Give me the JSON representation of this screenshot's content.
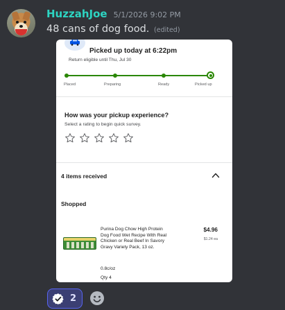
{
  "message": {
    "username": "HuzzahJoe",
    "timestamp": "5/1/2026 9:02 PM",
    "text": "48 cans of dog food.",
    "edited_label": "(edited)"
  },
  "embed": {
    "pickup_title": "Picked up today at 6:22pm",
    "return_note": "Return eligible until Thu, Jul 30",
    "progress_stages": [
      "Placed",
      "Preparing",
      "Ready",
      "Picked up"
    ],
    "rating_question": "How was your pickup experience?",
    "rating_subtitle": "Select a rating to begin quick survey.",
    "star_count": 5,
    "items_received": "4 items received",
    "section_label": "Shopped",
    "product": {
      "name": "Purina Dog Chow High Protein Dog Food Wet Recipe With Real Chicken or Real Beef In Savory Gravy Variety Pack, 13 oz.",
      "price": "$4.96",
      "price_each": "$1.24 ea",
      "unit_price": "0.8c/oz",
      "quantity": "Qty 4"
    }
  },
  "reactions": [
    {
      "icon": "check-badge-icon",
      "count": "2"
    }
  ],
  "colors": {
    "background": "#313338",
    "username": "#2dd4c2",
    "progress_green": "#2a8703",
    "reaction_bg": "#3b3f73",
    "reaction_border": "#5865f2"
  }
}
